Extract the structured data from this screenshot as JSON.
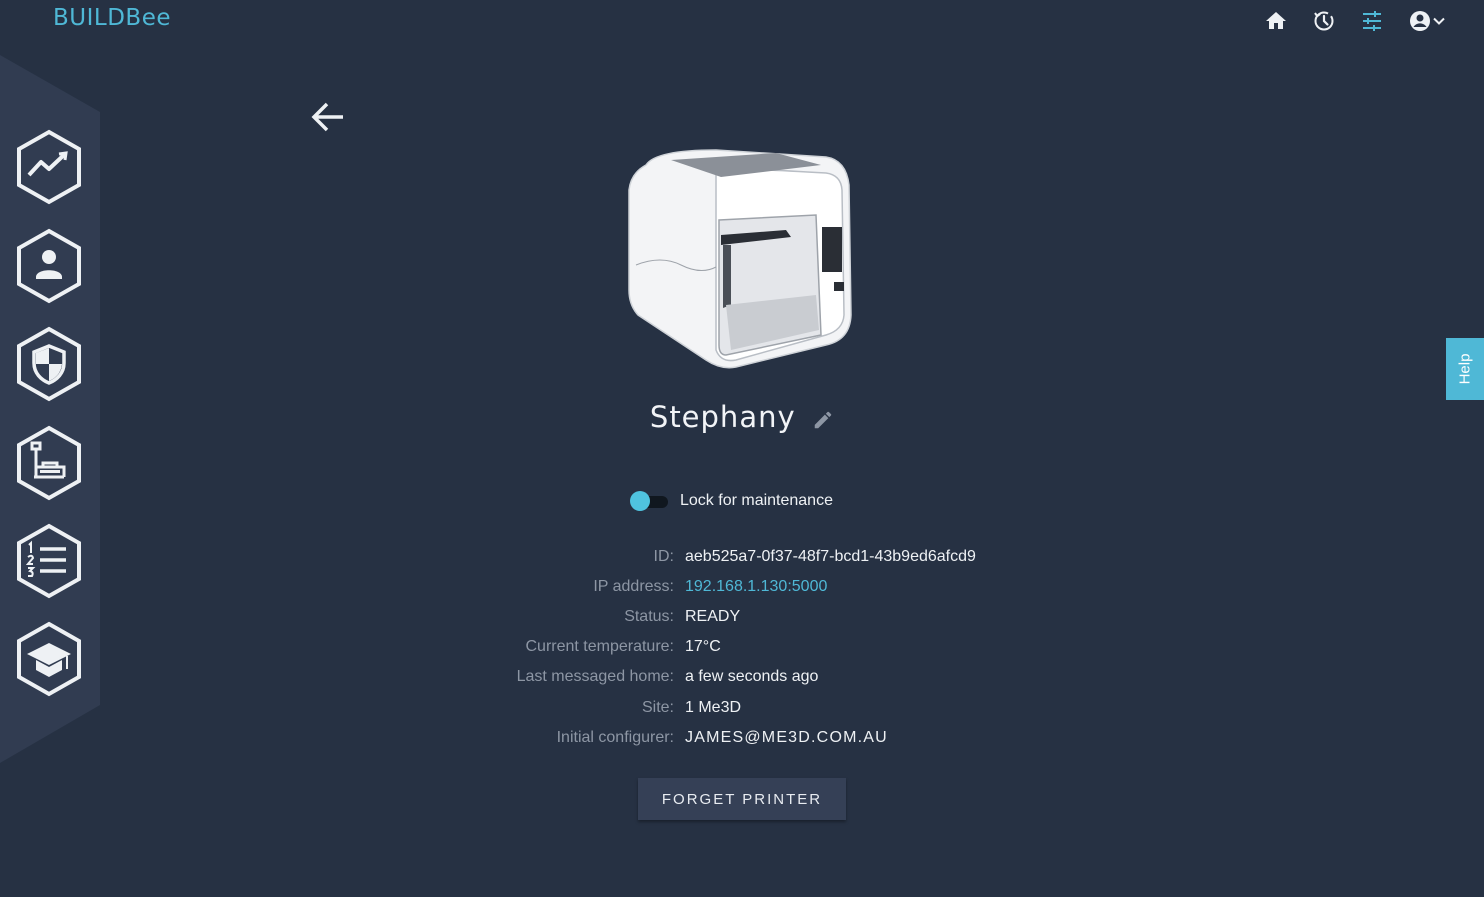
{
  "brand": {
    "logo_text": "BUILDBee"
  },
  "topnav": {
    "icons": [
      "home-icon",
      "history-icon",
      "settings-sliders-icon",
      "account-circle-icon",
      "chevron-down-icon"
    ]
  },
  "sidebar": {
    "items": [
      {
        "icon": "trending-chart-icon"
      },
      {
        "icon": "user-icon"
      },
      {
        "icon": "shield-icon"
      },
      {
        "icon": "printer-machine-icon"
      },
      {
        "icon": "numbered-list-icon"
      },
      {
        "icon": "graduation-cap-icon"
      }
    ]
  },
  "printer": {
    "name": "Stephany",
    "lock_label": "Lock for maintenance",
    "details": [
      {
        "key": "ID:",
        "value": "aeb525a7-0f37-48f7-bcd1-43b9ed6afcd9"
      },
      {
        "key": "IP address:",
        "value": "192.168.1.130:5000"
      },
      {
        "key": "Status:",
        "value": "READY"
      },
      {
        "key": "Current temperature:",
        "value": "17°C"
      },
      {
        "key": "Last messaged home:",
        "value": "a few seconds ago"
      },
      {
        "key": "Site:",
        "value": "1 Me3D"
      },
      {
        "key": "Initial configurer:",
        "value": "JAMES@ME3D.COM.AU"
      }
    ],
    "forget_button": "FORGET PRINTER"
  },
  "help": {
    "label": "Help"
  },
  "colors": {
    "background": "#263143",
    "accent": "#4fb8d6",
    "sidebar": "#313c51"
  }
}
